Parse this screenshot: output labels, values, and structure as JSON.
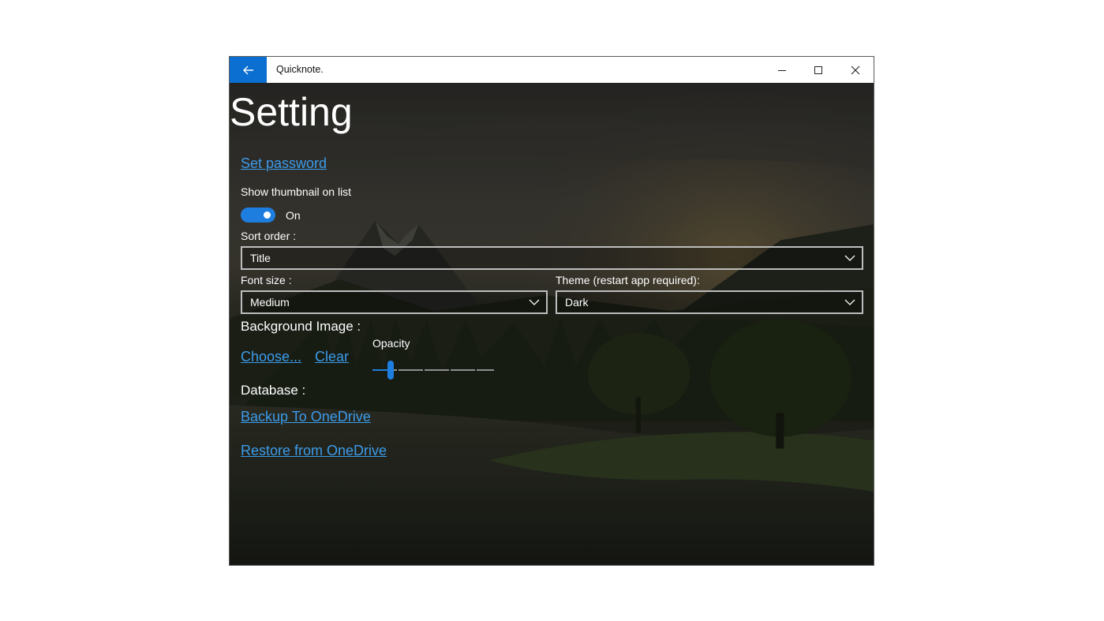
{
  "window": {
    "title": "Quicknote.",
    "back_icon": "arrow-left-icon",
    "controls": [
      "minimize-icon",
      "maximize-icon",
      "close-icon"
    ]
  },
  "page": {
    "title": "Setting"
  },
  "settings": {
    "set_password": "Set password",
    "thumbnail_label": "Show thumbnail on list",
    "thumbnail_toggle": {
      "state": "On",
      "checked": true
    },
    "sort_order_label": "Sort order :",
    "sort_order_value": "Title",
    "font_size_label": "Font size :",
    "font_size_value": "Medium",
    "theme_label": "Theme (restart app required):",
    "theme_value": "Dark",
    "background_label": "Background Image :",
    "choose_link": "Choose...",
    "clear_link": "Clear",
    "opacity_label": "Opacity",
    "opacity_value": 0.13,
    "database_label": "Database :",
    "backup_link": "Backup To OneDrive",
    "restore_link": "Restore from OneDrive"
  },
  "colors": {
    "accent": "#0a6fd0",
    "link": "#3b9bea",
    "toggle_on": "#1e7ee0"
  }
}
